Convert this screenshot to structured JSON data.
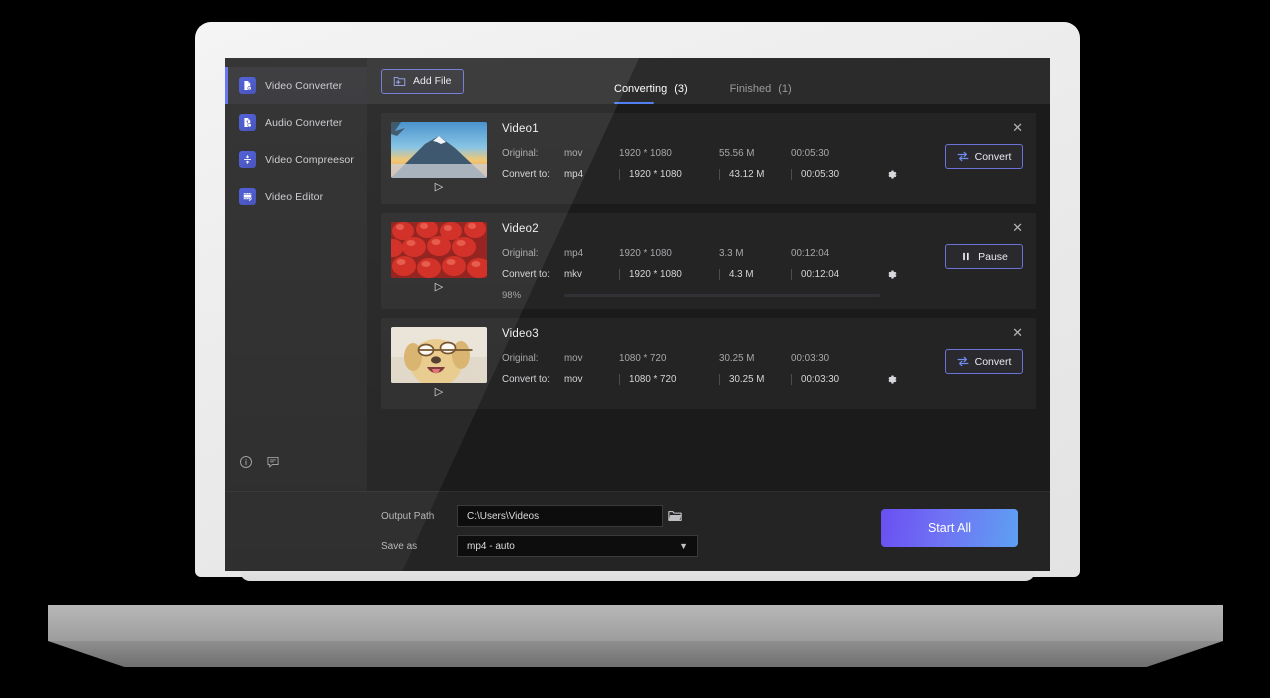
{
  "sidebar": {
    "items": [
      {
        "label": "Video Converter",
        "icon": "video-converter-icon",
        "active": true
      },
      {
        "label": "Audio Converter",
        "icon": "audio-converter-icon",
        "active": false
      },
      {
        "label": "Video Compreesor",
        "icon": "video-compressor-icon",
        "active": false
      },
      {
        "label": "Video Editor",
        "icon": "video-editor-icon",
        "active": false
      }
    ],
    "bottom_icons": [
      {
        "name": "info-icon"
      },
      {
        "name": "feedback-icon"
      }
    ]
  },
  "toolbar": {
    "add_file_label": "Add File",
    "add_file_icon": "folder-plus-icon"
  },
  "tabs": [
    {
      "label": "Converting",
      "count": "(3)",
      "active": true
    },
    {
      "label": "Finished",
      "count": "(1)",
      "active": false
    }
  ],
  "columns": {
    "original_label": "Original:",
    "convert_to_label": "Convert to:"
  },
  "files": [
    {
      "title": "Video1",
      "thumbnail": "mountain-sunset-thumbnail",
      "original": {
        "format": "mov",
        "resolution": "1920 * 1080",
        "size": "55.56 M",
        "duration": "00:05:30"
      },
      "convert_to": {
        "format": "mp4",
        "resolution": "1920  * 1080",
        "size": "43.12 M",
        "duration": "00:05:30"
      },
      "action": "Convert",
      "action_icon": "convert-swap-icon",
      "progress": null,
      "progress_label": null
    },
    {
      "title": "Video2",
      "thumbnail": "strawberries-thumbnail",
      "original": {
        "format": "mp4",
        "resolution": "1920 * 1080",
        "size": "3.3 M",
        "duration": "00:12:04"
      },
      "convert_to": {
        "format": "mkv",
        "resolution": "1920  * 1080",
        "size": "4.3 M",
        "duration": "00:12:04"
      },
      "action": "Pause",
      "action_icon": "pause-icon",
      "progress": 98,
      "progress_label": "98%"
    },
    {
      "title": "Video3",
      "thumbnail": "dog-with-glasses-thumbnail",
      "original": {
        "format": "mov",
        "resolution": "1080 * 720",
        "size": "30.25 M",
        "duration": "00:03:30"
      },
      "convert_to": {
        "format": "mov",
        "resolution": "1080  * 720",
        "size": "30.25 M",
        "duration": "00:03:30"
      },
      "action": "Convert",
      "action_icon": "convert-swap-icon",
      "progress": null,
      "progress_label": null
    }
  ],
  "bottom": {
    "output_path_label": "Output Path",
    "output_path_value": "C:\\Users\\Videos",
    "folder_icon": "folder-browse-icon",
    "save_as_label": "Save as",
    "save_as_value": "mp4 - auto",
    "start_all_label": "Start All"
  },
  "colors": {
    "accent_blue": "#5b6bf0",
    "tab_underline": "#4f7ff0",
    "button_border": "#6b73d8",
    "progress_start": "#4b30e8",
    "progress_end": "#6f9af5",
    "panel_bg": "#242424",
    "screen_bg": "#1b1b1b"
  }
}
